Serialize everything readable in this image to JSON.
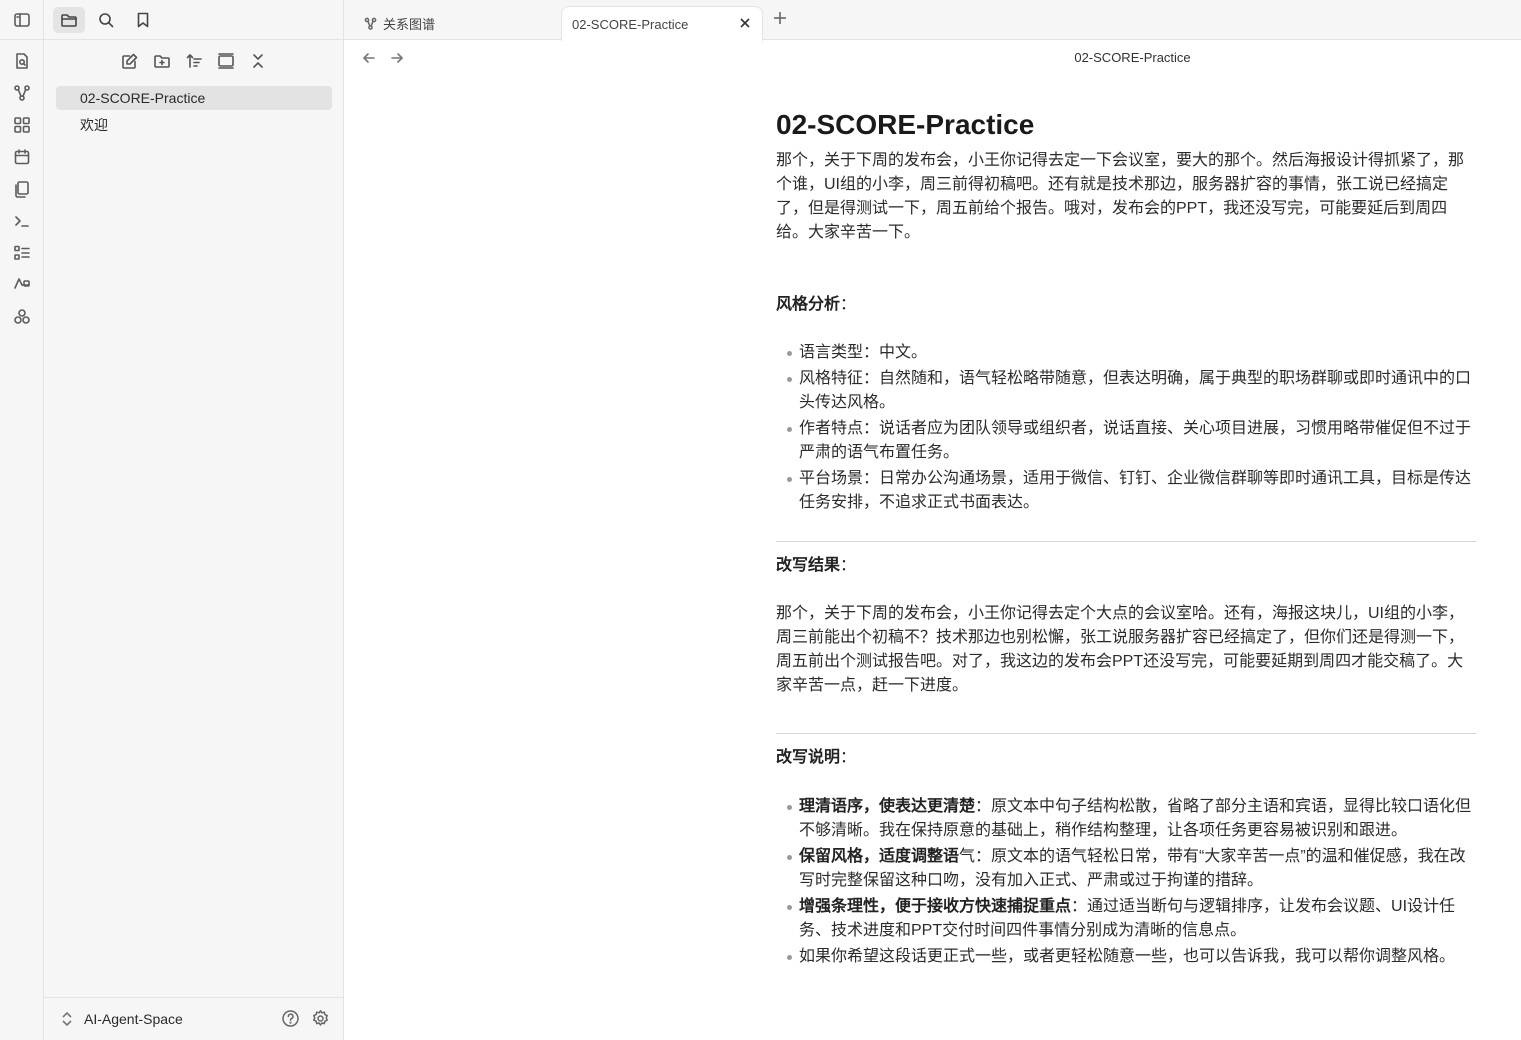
{
  "sidebar": {
    "files": [
      {
        "label": "02-SCORE-Practice",
        "active": true
      },
      {
        "label": "欢迎",
        "active": false
      }
    ],
    "vault_name": "AI-Agent-Space"
  },
  "tabs": [
    {
      "label": "关系图谱",
      "icon": "graph-icon",
      "active": false
    },
    {
      "label": "02-SCORE-Practice",
      "icon": "",
      "active": true
    }
  ],
  "view": {
    "title": "02-SCORE-Practice"
  },
  "note": {
    "title": "02-SCORE-Practice",
    "intro": "那个，关于下周的发布会，小王你记得去定一下会议室，要大的那个。然后海报设计得抓紧了，那个谁，UI组的小李，周三前得初稿吧。还有就是技术那边，服务器扩容的事情，张工说已经搞定了，但是得测试一下，周五前给个报告。哦对，发布会的PPT，我还没写完，可能要延后到周四给。大家辛苦一下。",
    "style_heading": "风格分析",
    "style_items": [
      "语言类型：中文。",
      "风格特征：自然随和，语气轻松略带随意，但表达明确，属于典型的职场群聊或即时通讯中的口头传达风格。",
      "作者特点：说话者应为团队领导或组织者，说话直接、关心项目进展，习惯用略带催促但不过于严肃的语气布置任务。",
      "平台场景：日常办公沟通场景，适用于微信、钉钉、企业微信群聊等即时通讯工具，目标是传达任务安排，不追求正式书面表达。"
    ],
    "result_heading": "改写结果",
    "result_text": "那个，关于下周的发布会，小王你记得去定个大点的会议室哈。还有，海报这块儿，UI组的小李，周三前能出个初稿不？技术那边也别松懈，张工说服务器扩容已经搞定了，但你们还是得测一下，周五前出个测试报告吧。对了，我这边的发布会PPT还没写完，可能要延期到周四才能交稿了。大家辛苦一点，赶一下进度。",
    "explain_heading": "改写说明",
    "explain_items": [
      {
        "bold": "理清语序，使表达更清楚",
        "text": "：原文本中句子结构松散，省略了部分主语和宾语，显得比较口语化但不够清晰。我在保持原意的基础上，稍作结构整理，让各项任务更容易被识别和跟进。"
      },
      {
        "bold": "保留风格，适度调整语",
        "text": "气：原文本的语气轻松日常，带有“大家辛苦一点”的温和催促感，我在改写时完整保留这种口吻，没有加入正式、严肃或过于拘谨的措辞。"
      },
      {
        "bold": "增强条理性，便于接收方快速捕捉重点",
        "text": "：通过适当断句与逻辑排序，让发布会议题、UI设计任务、技术进度和PPT交付时间四件事情分别成为清晰的信息点。"
      },
      {
        "bold": "",
        "text": "如果你希望这段话更正式一些，或者更轻松随意一些，也可以告诉我，我可以帮你调整风格。"
      }
    ],
    "colon": "："
  }
}
